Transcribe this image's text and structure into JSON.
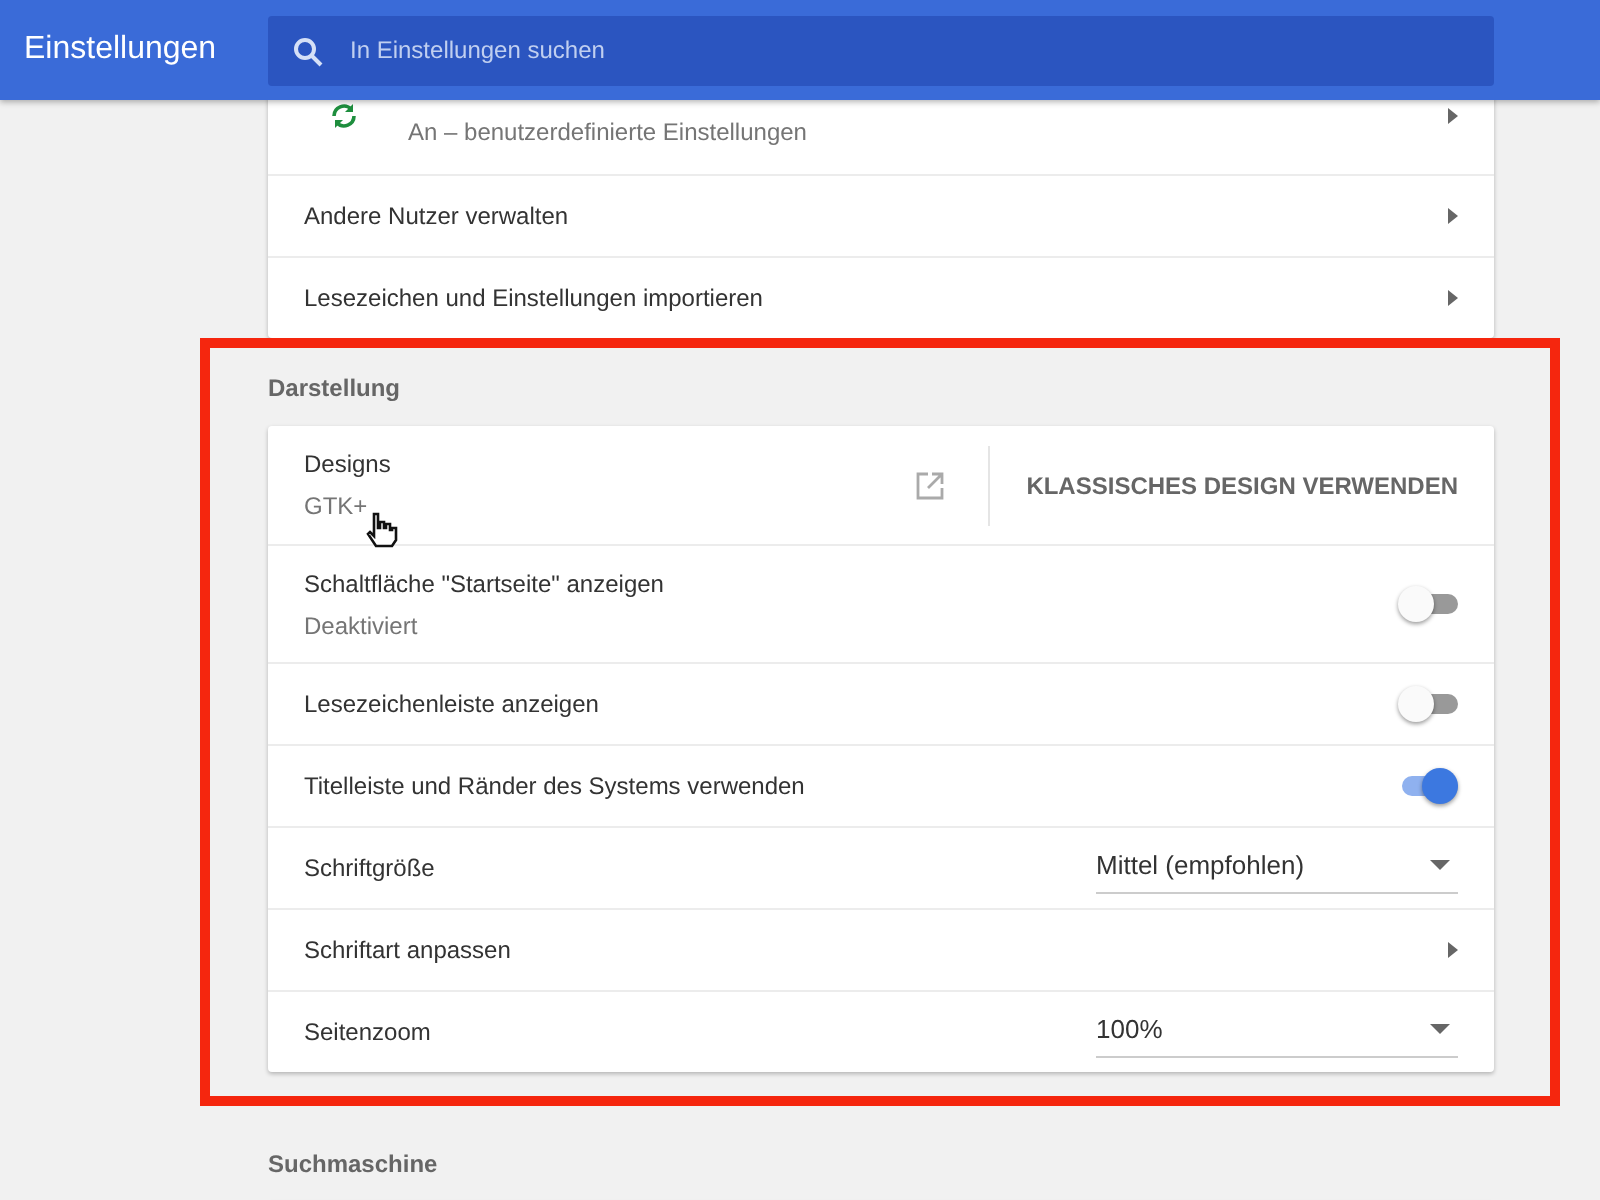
{
  "header": {
    "title": "Einstellungen",
    "search": {
      "placeholder": "In Einstellungen suchen"
    }
  },
  "sections": [
    {
      "rows": [
        {
          "kind": "sync-link",
          "subtitle": "An – benutzerdefinierte Einstellungen"
        },
        {
          "kind": "link",
          "title": "Andere Nutzer verwalten"
        },
        {
          "kind": "link",
          "title": "Lesezeichen und Einstellungen importieren"
        }
      ]
    },
    {
      "title": "Darstellung",
      "highlighted": true,
      "rows": [
        {
          "kind": "theme",
          "title": "Designs",
          "subtitle": "GTK+",
          "button": "KLASSISCHES DESIGN VERWENDEN",
          "pointer": true
        },
        {
          "kind": "toggle",
          "title": "Schaltfläche \"Startseite\" anzeigen",
          "subtitle": "Deaktiviert",
          "on": false
        },
        {
          "kind": "toggle",
          "title": "Lesezeichenleiste anzeigen",
          "on": false
        },
        {
          "kind": "toggle",
          "title": "Titelleiste und Ränder des Systems verwenden",
          "on": true
        },
        {
          "kind": "select",
          "title": "Schriftgröße",
          "value": "Mittel (empfohlen)"
        },
        {
          "kind": "link",
          "title": "Schriftart anpassen"
        },
        {
          "kind": "select",
          "title": "Seitenzoom",
          "value": "100%"
        }
      ]
    },
    {
      "title": "Suchmaschine",
      "highlighted": false
    }
  ]
}
